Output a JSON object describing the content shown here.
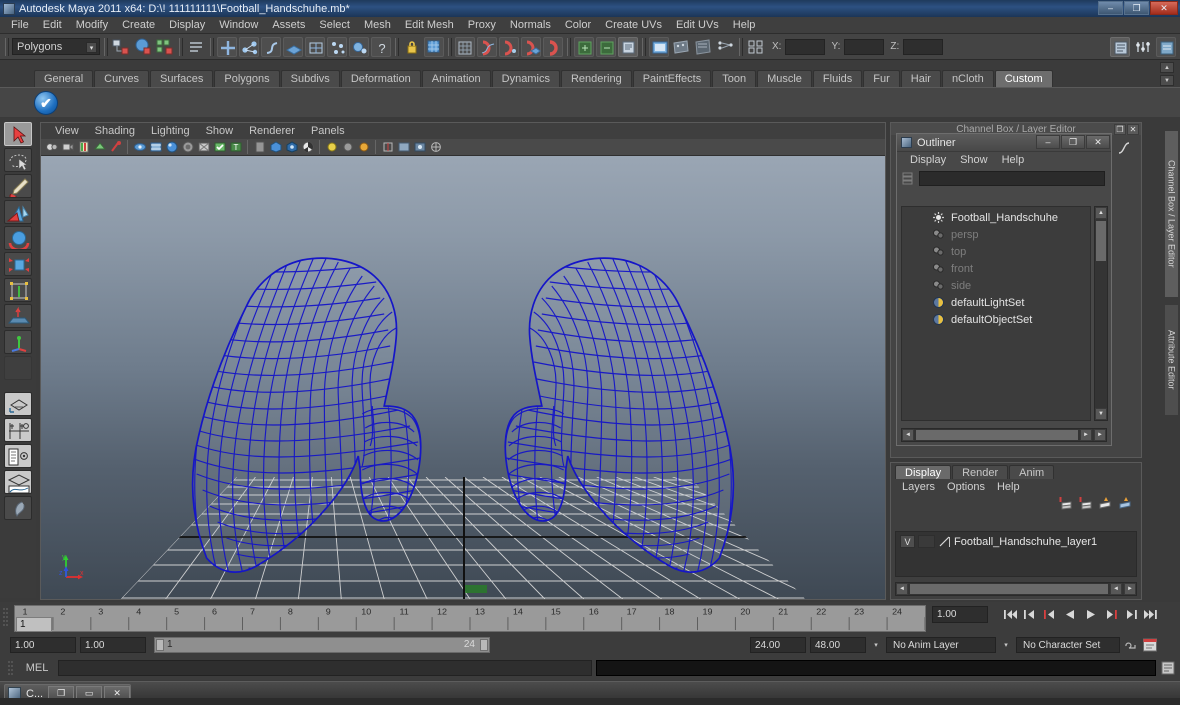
{
  "window": {
    "title": "Autodesk Maya 2011 x64: D:\\! 111111111\\Football_Handschuhe.mb*",
    "minimize": "–",
    "restore": "❐",
    "close": "✕"
  },
  "menubar": {
    "items": [
      "File",
      "Edit",
      "Modify",
      "Create",
      "Display",
      "Window",
      "Assets",
      "Select",
      "Mesh",
      "Edit Mesh",
      "Proxy",
      "Normals",
      "Color",
      "Create UVs",
      "Edit UVs",
      "Help"
    ]
  },
  "statusbar": {
    "mode": "Polygons",
    "mode_arrow": "▾",
    "coord_labels": [
      "X:",
      "Y:",
      "Z:"
    ],
    "coord_values": [
      "",
      "",
      ""
    ]
  },
  "shelf": {
    "tabs": [
      "General",
      "Curves",
      "Surfaces",
      "Polygons",
      "Subdivs",
      "Deformation",
      "Animation",
      "Dynamics",
      "Rendering",
      "PaintEffects",
      "Toon",
      "Muscle",
      "Fluids",
      "Fur",
      "Hair",
      "nCloth",
      "Custom"
    ],
    "active_tab": "Custom",
    "icon": "blue-check-icon",
    "icon_glyph": "✔"
  },
  "toolbox": {
    "items": [
      {
        "name": "select-tool",
        "selected": true
      },
      {
        "name": "lasso-select-tool",
        "selected": false
      },
      {
        "name": "paint-select-tool",
        "selected": false
      },
      {
        "name": "move-tool",
        "selected": false
      },
      {
        "name": "rotate-tool",
        "selected": false
      },
      {
        "name": "scale-tool",
        "selected": false
      },
      {
        "name": "universal-manipulator-tool",
        "selected": false
      },
      {
        "name": "soft-modification-tool",
        "selected": false
      },
      {
        "name": "show-manipulator-tool",
        "selected": false
      },
      {
        "name": "last-tool-used",
        "selected": false
      },
      {
        "name": "layout-single-perspective",
        "selected": false
      },
      {
        "name": "layout-four-view",
        "selected": false
      },
      {
        "name": "layout-outliner-persp",
        "selected": false
      },
      {
        "name": "layout-persp-graph",
        "selected": false
      },
      {
        "name": "paint-effects-toggle",
        "selected": false
      }
    ]
  },
  "viewport": {
    "menu": [
      "View",
      "Shading",
      "Lighting",
      "Show",
      "Renderer",
      "Panels"
    ],
    "axis": {
      "x": "x",
      "y": "y",
      "z": "z"
    },
    "axis_colors": {
      "x": "#e03030",
      "y": "#30d030",
      "z": "#3050e0"
    },
    "wireframe_color": "#1515c8",
    "grid_color": "#d8d8d8",
    "background_top": "#9aa6b4",
    "background_bottom": "#3f4954",
    "model_name": "Football_Handschuhe"
  },
  "outliner": {
    "title": "Outliner",
    "title_icon": "outliner-icon",
    "minimize": "–",
    "maximize": "❐",
    "close": "✕",
    "menu": [
      "Display",
      "Show",
      "Help"
    ],
    "search_value": "",
    "items": [
      {
        "label": "Football_Handschuhe",
        "icon": "mesh-icon",
        "dim": false
      },
      {
        "label": "persp",
        "icon": "camera-icon",
        "dim": true
      },
      {
        "label": "top",
        "icon": "camera-icon",
        "dim": true
      },
      {
        "label": "front",
        "icon": "camera-icon",
        "dim": true
      },
      {
        "label": "side",
        "icon": "camera-icon",
        "dim": true
      },
      {
        "label": "defaultLightSet",
        "icon": "set-icon",
        "dim": false
      },
      {
        "label": "defaultObjectSet",
        "icon": "set-icon",
        "dim": false
      }
    ],
    "scroll_up": "▲",
    "scroll_down": "▼",
    "scroll_left": "◄",
    "scroll_right": "►"
  },
  "channelbox": {
    "title": "Channel Box / Layer Editor",
    "restore": "❐",
    "close": "✕"
  },
  "layer_editor": {
    "tabs": [
      "Display",
      "Render",
      "Anim"
    ],
    "active_tab": "Display",
    "menu": [
      "Layers",
      "Options",
      "Help"
    ],
    "layers": [
      {
        "visibility": "V",
        "name": "Football_Handschuhe_layer1"
      }
    ],
    "buttons": [
      "new-layer-icon",
      "new-layer-from-selected-icon",
      "layer-up-icon",
      "layer-down-icon"
    ]
  },
  "side_tabs": [
    {
      "label": "Channel Box / Layer Editor",
      "active": true
    },
    {
      "label": "Attribute Editor",
      "active": false
    }
  ],
  "timeline": {
    "ticks": [
      "1",
      "2",
      "3",
      "4",
      "5",
      "6",
      "7",
      "8",
      "9",
      "10",
      "11",
      "12",
      "13",
      "14",
      "15",
      "16",
      "17",
      "18",
      "19",
      "20",
      "21",
      "22",
      "23",
      "24"
    ],
    "current_frame": "1",
    "current_time_field": "1.00",
    "playback_buttons": [
      "go-to-start-icon",
      "step-back-keyframe-icon",
      "step-back-frame-icon",
      "play-backwards-icon",
      "play-forwards-icon",
      "step-forward-frame-icon",
      "step-forward-keyframe-icon",
      "go-to-end-icon"
    ],
    "playback_glyphs": [
      "⏮",
      "◀|",
      "|◀",
      "◀",
      "▶",
      "▶|",
      "|▶",
      "⏭"
    ]
  },
  "range": {
    "anim_start": "1.00",
    "range_start": "1.00",
    "slider_min": "1",
    "slider_max": "24",
    "range_end": "24.00",
    "anim_end": "48.00",
    "anim_layer": "No Anim Layer",
    "character_set": "No Character Set",
    "caret": "▾"
  },
  "mel": {
    "label": "MEL",
    "command_value": "",
    "output_value": ""
  },
  "taskbar": {
    "item_label": "C...",
    "restore": "❐",
    "maximize": "▭",
    "close": "✕"
  }
}
